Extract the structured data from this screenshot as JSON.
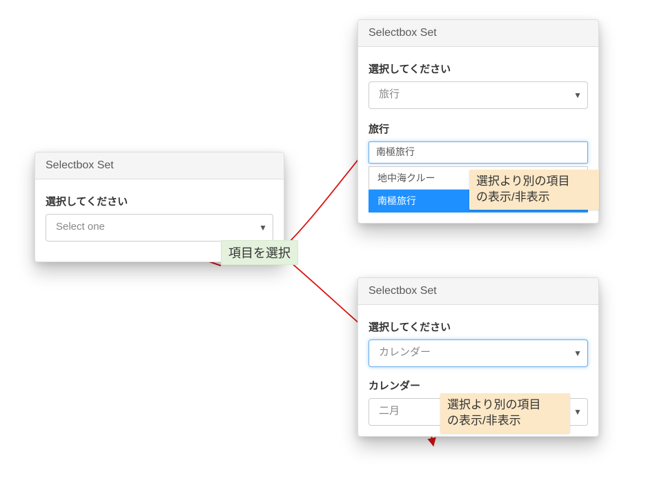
{
  "annotations": {
    "select_item": "項目を選択",
    "toggle_visibility_line1": "選択より別の項目",
    "toggle_visibility_line2": "の表示/非表示"
  },
  "panel1": {
    "title": "Selectbox Set",
    "label": "選択してください",
    "select_value": "Select one"
  },
  "panel2": {
    "title": "Selectbox Set",
    "label1": "選択してください",
    "select1_value": "旅行",
    "label2": "旅行",
    "search_value": "南極旅行",
    "option1": "地中海クルー",
    "option2": "南極旅行"
  },
  "panel3": {
    "title": "Selectbox Set",
    "label1": "選択してください",
    "select1_value": "カレンダー",
    "label2": "カレンダー",
    "select2_value": "二月"
  }
}
